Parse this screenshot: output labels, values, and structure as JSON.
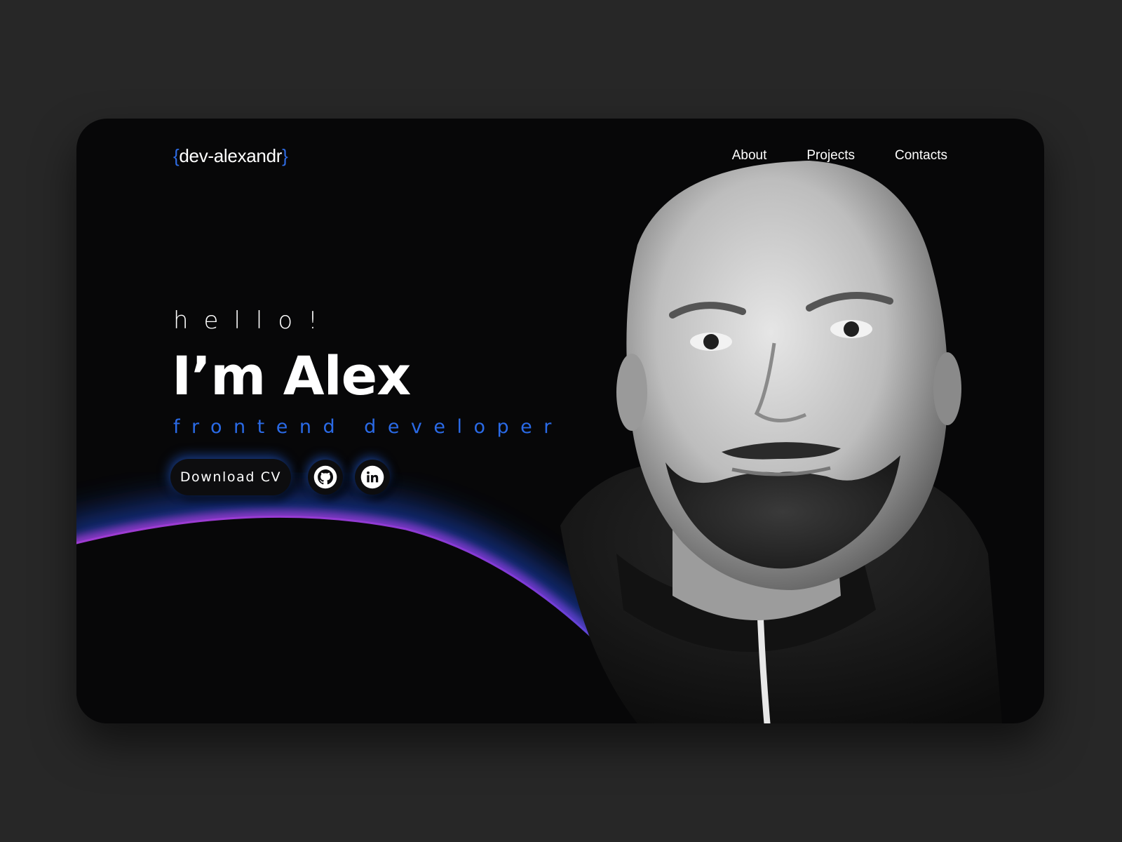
{
  "header": {
    "logo": {
      "open_brace": "{",
      "text": "dev-alexandr",
      "close_brace": "}"
    },
    "nav": [
      {
        "label": "About"
      },
      {
        "label": "Projects"
      },
      {
        "label": "Contacts"
      }
    ]
  },
  "hero": {
    "greeting": "hello!",
    "name": "I’m Alex",
    "role": "frontend developer",
    "cv_button": "Download CV",
    "social": [
      {
        "icon": "github-icon"
      },
      {
        "icon": "linkedin-icon"
      }
    ]
  },
  "colors": {
    "page_bg": "#272727",
    "card_bg": "#070708",
    "accent_blue": "#2a6ae6",
    "accent_purple": "#a23bd0"
  }
}
